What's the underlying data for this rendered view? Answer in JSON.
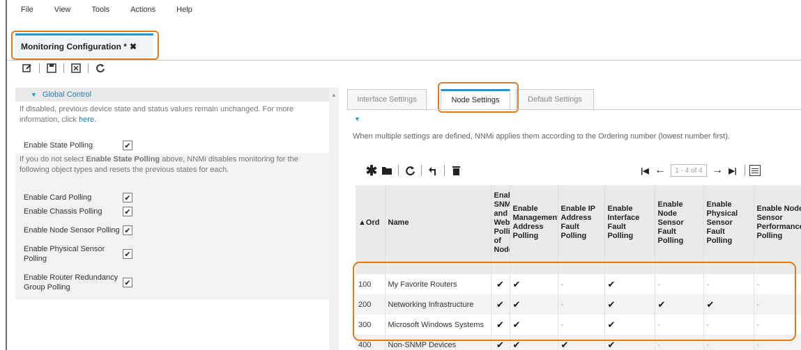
{
  "menu": [
    "File",
    "View",
    "Tools",
    "Actions",
    "Help"
  ],
  "workspace_tab": {
    "title": "Monitoring Configuration *",
    "close": "✖"
  },
  "left": {
    "section_title": "Global Control",
    "desc1": "If disabled, previous device state and status values remain unchanged. For more information, click",
    "desc1_link": "here.",
    "state_polling_label": "Enable State Polling",
    "desc2_prefix": "If you do not select",
    "desc2_bold": "Enable State Polling",
    "desc2_suffix": "above, NNMi disables monitoring for the following object types and resets the previous states for each.",
    "items": [
      {
        "label": "Enable Card Polling",
        "checked": "✔"
      },
      {
        "label": "Enable Chassis Polling",
        "checked": "✔"
      },
      {
        "label": "Enable Node Sensor Polling",
        "checked": "✔"
      },
      {
        "label": "Enable Physical Sensor Polling",
        "checked": "✔"
      },
      {
        "label": "Enable Router Redundancy Group Polling",
        "checked": "✔"
      }
    ],
    "state_polling_checked": "✔"
  },
  "tabs": [
    "Interface Settings",
    "Node Settings",
    "Default Settings"
  ],
  "ordering_note": "When multiple settings are defined, NNMi applies them according to the Ordering number (lowest number first).",
  "pager": {
    "range": "1 - 4 of 4"
  },
  "table": {
    "headers": [
      "▲Ord",
      "Name",
      "Enable SNMP and Web Polling of Nodes",
      "Enable Management Address Polling",
      "Enable IP Address Fault Polling",
      "Enable Interface Fault Polling",
      "Enable Node Sensor Fault Polling",
      "Enable Physical Sensor Fault Polling",
      "Enable Node Sensor Performance Polling"
    ],
    "rows": [
      [
        "100",
        "My Favorite Routers",
        "✔",
        "✔",
        "-",
        "✔",
        "-",
        "-",
        "-"
      ],
      [
        "200",
        "Networking Infrastructure",
        "✔",
        "✔",
        "-",
        "✔",
        "✔",
        "✔",
        "-"
      ],
      [
        "300",
        "Microsoft Windows Systems",
        "✔",
        "✔",
        "-",
        "✔",
        "-",
        "-",
        "-"
      ],
      [
        "400",
        "Non-SNMP Devices",
        "✔",
        "✔",
        "✔",
        "✔",
        "-",
        "-",
        "-"
      ]
    ]
  },
  "colors": {
    "accent": "#2a93c9",
    "highlight": "#e07a20"
  },
  "icons": [
    "edit-icon",
    "save-icon",
    "save-close-icon",
    "refresh-icon",
    "new-icon",
    "open-icon",
    "undo-icon",
    "delete-icon",
    "first-page-icon",
    "prev-page-icon",
    "next-page-icon",
    "last-page-icon",
    "table-menu-icon"
  ]
}
